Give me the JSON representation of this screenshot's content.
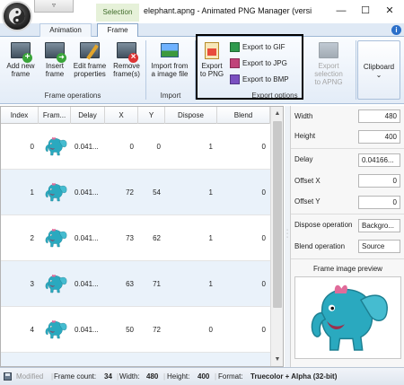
{
  "window": {
    "title": "elephant.apng - Animated PNG Manager (versi",
    "contextual_tab": "Selection",
    "qat_glyph": "▿",
    "minimize_glyph": "—",
    "maximize_glyph": "☐",
    "close_glyph": "✕"
  },
  "tabs": [
    {
      "label": "Animation",
      "active": false
    },
    {
      "label": "Frame",
      "active": true
    }
  ],
  "help_glyph": "i",
  "ribbon": {
    "frame_operations": {
      "label": "Frame operations",
      "buttons": [
        {
          "line1": "Add new",
          "line2": "frame",
          "icon": "add-frame-icon"
        },
        {
          "line1": "Insert",
          "line2": "frame",
          "icon": "insert-frame-icon"
        },
        {
          "line1": "Edit frame",
          "line2": "properties",
          "icon": "edit-frame-icon"
        },
        {
          "line1": "Remove",
          "line2": "frame(s)",
          "icon": "remove-frame-icon"
        }
      ]
    },
    "import": {
      "label": "Import",
      "button": {
        "line1": "Import from",
        "line2": "a image file",
        "icon": "image-file-icon"
      }
    },
    "export": {
      "label": "Export options",
      "png": {
        "line1": "Export",
        "line2": "to PNG",
        "icon": "png-export-icon"
      },
      "gif": "Export to GIF",
      "jpg": "Export to JPG",
      "bmp": "Export to BMP",
      "apng": {
        "line1": "Export selection",
        "line2": "to APNG",
        "icon": "apng-export-icon"
      }
    },
    "clipboard": {
      "label": "Clipboard",
      "arrow": "⌄",
      "icon": "clipboard-icon"
    }
  },
  "table": {
    "columns": [
      "Index",
      "Fram...",
      "Delay",
      "X",
      "Y",
      "Dispose",
      "Blend"
    ],
    "rows": [
      {
        "index": "0",
        "delay": "0.041...",
        "x": "0",
        "y": "0",
        "dispose": "1",
        "blend": "0"
      },
      {
        "index": "1",
        "delay": "0.041...",
        "x": "72",
        "y": "54",
        "dispose": "1",
        "blend": "0"
      },
      {
        "index": "2",
        "delay": "0.041...",
        "x": "73",
        "y": "62",
        "dispose": "1",
        "blend": "0"
      },
      {
        "index": "3",
        "delay": "0.041...",
        "x": "63",
        "y": "71",
        "dispose": "1",
        "blend": "0"
      },
      {
        "index": "4",
        "delay": "0.041...",
        "x": "50",
        "y": "72",
        "dispose": "0",
        "blend": "0"
      }
    ],
    "scroll_up": "▲",
    "scroll_down": "▼"
  },
  "properties": {
    "width_label": "Width",
    "width_value": "480",
    "height_label": "Height",
    "height_value": "400",
    "delay_label": "Delay",
    "delay_value": "0.04166...",
    "offset_x_label": "Offset X",
    "offset_x_value": "0",
    "offset_y_label": "Offset Y",
    "offset_y_value": "0",
    "dispose_label": "Dispose operation",
    "dispose_value": "Backgro...",
    "blend_label": "Blend operation",
    "blend_value": "Source",
    "preview_title": "Frame image preview"
  },
  "status": {
    "modified": "Modified",
    "frame_count_label": "Frame count:",
    "frame_count": "34",
    "width_label": "Width:",
    "width": "480",
    "height_label": "Height:",
    "height": "400",
    "format_label": "Format:",
    "format": "Truecolor + Alpha (32-bit)"
  },
  "colors": {
    "accent_blue": "#2b6fc9",
    "elephant_teal": "#2aa9bf",
    "elephant_pink": "#e06b9a",
    "row_alt": "#eaf2fa",
    "context_tab_bg": "#e6f1d9"
  }
}
